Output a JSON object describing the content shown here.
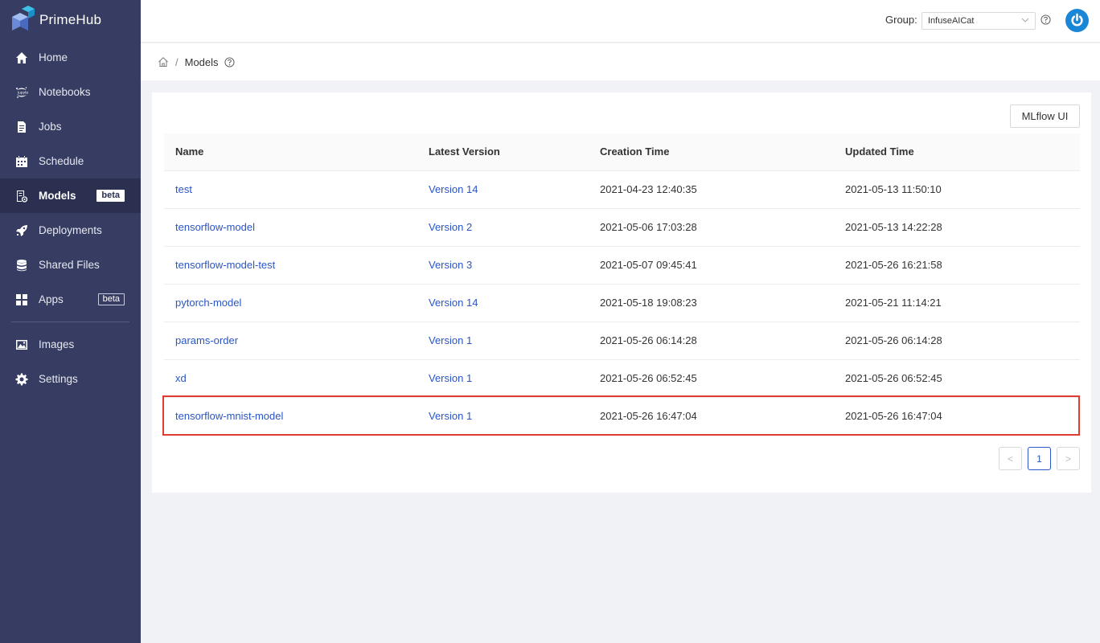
{
  "brand": {
    "name": "PrimeHub"
  },
  "sidebar": {
    "items": [
      {
        "label": "Home",
        "icon": "home-icon"
      },
      {
        "label": "Notebooks",
        "icon": "jupyter-icon"
      },
      {
        "label": "Jobs",
        "icon": "jobs-icon"
      },
      {
        "label": "Schedule",
        "icon": "calendar-icon"
      },
      {
        "label": "Models",
        "icon": "models-icon",
        "badge": "beta",
        "active": true
      },
      {
        "label": "Deployments",
        "icon": "rocket-icon"
      },
      {
        "label": "Shared Files",
        "icon": "database-icon"
      },
      {
        "label": "Apps",
        "icon": "apps-icon",
        "badge": "beta"
      },
      {
        "label": "Images",
        "icon": "image-icon"
      },
      {
        "label": "Settings",
        "icon": "gear-icon"
      }
    ]
  },
  "header": {
    "group_label": "Group:",
    "group_value": "InfuseAICat"
  },
  "breadcrumb": {
    "sep": "/",
    "current": "Models"
  },
  "toolbar": {
    "mlflow_label": "MLflow UI"
  },
  "table": {
    "headers": [
      "Name",
      "Latest Version",
      "Creation Time",
      "Updated Time"
    ],
    "rows": [
      {
        "name": "test",
        "version": "Version 14",
        "created": "2021-04-23 12:40:35",
        "updated": "2021-05-13 11:50:10"
      },
      {
        "name": "tensorflow-model",
        "version": "Version 2",
        "created": "2021-05-06 17:03:28",
        "updated": "2021-05-13 14:22:28"
      },
      {
        "name": "tensorflow-model-test",
        "version": "Version 3",
        "created": "2021-05-07 09:45:41",
        "updated": "2021-05-26 16:21:58"
      },
      {
        "name": "pytorch-model",
        "version": "Version 14",
        "created": "2021-05-18 19:08:23",
        "updated": "2021-05-21 11:14:21"
      },
      {
        "name": "params-order",
        "version": "Version 1",
        "created": "2021-05-26 06:14:28",
        "updated": "2021-05-26 06:14:28"
      },
      {
        "name": "xd",
        "version": "Version 1",
        "created": "2021-05-26 06:52:45",
        "updated": "2021-05-26 06:52:45"
      },
      {
        "name": "tensorflow-mnist-model",
        "version": "Version 1",
        "created": "2021-05-26 16:47:04",
        "updated": "2021-05-26 16:47:04"
      }
    ]
  },
  "pagination": {
    "prev": "<",
    "current": "1",
    "next": ">"
  },
  "colors": {
    "sidebar": "#373d62",
    "sidebar_active": "#2b3050",
    "link": "#2a55c5",
    "highlight": "#e03c31"
  }
}
